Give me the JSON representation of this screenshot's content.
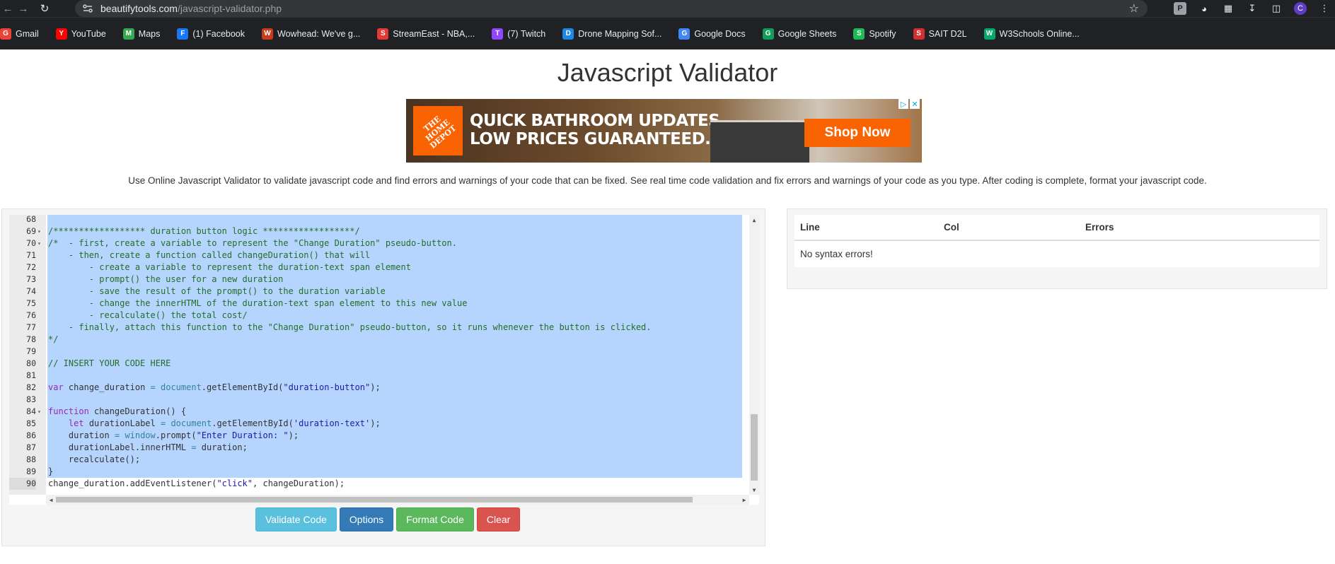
{
  "browser": {
    "url_host": "beautifytools.com",
    "url_path": "/javascript-validator.php",
    "bookmarks": [
      {
        "label": "Gmail",
        "icon": "gmail-icon",
        "color": "#ea4335"
      },
      {
        "label": "YouTube",
        "icon": "youtube-icon",
        "color": "#ff0000"
      },
      {
        "label": "Maps",
        "icon": "maps-icon",
        "color": "#34a853"
      },
      {
        "label": "(1) Facebook",
        "icon": "facebook-icon",
        "color": "#1877f2"
      },
      {
        "label": "Wowhead: We've g...",
        "icon": "wowhead-icon",
        "color": "#c83c1e"
      },
      {
        "label": "StreamEast - NBA,...",
        "icon": "streameast-icon",
        "color": "#e53935"
      },
      {
        "label": "(7) Twitch",
        "icon": "twitch-icon",
        "color": "#9146ff"
      },
      {
        "label": "Drone Mapping Sof...",
        "icon": "drone-icon",
        "color": "#1e88e5"
      },
      {
        "label": "Google Docs",
        "icon": "google-docs-icon",
        "color": "#4285f4"
      },
      {
        "label": "Google Sheets",
        "icon": "google-sheets-icon",
        "color": "#0f9d58"
      },
      {
        "label": "Spotify",
        "icon": "spotify-icon",
        "color": "#1db954"
      },
      {
        "label": "SAIT D2L",
        "icon": "sait-icon",
        "color": "#d32f2f"
      },
      {
        "label": "W3Schools Online...",
        "icon": "w3schools-icon",
        "color": "#04aa6d"
      }
    ],
    "avatar_letter": "C"
  },
  "page": {
    "title": "Javascript Validator",
    "description": "Use Online Javascript Validator to validate javascript code and find errors and warnings of your code that can be fixed. See real time code validation and fix errors and warnings of your code as you type. After coding is complete, format your javascript code."
  },
  "ad": {
    "logo_text": "THE HOME DEPOT",
    "headline_1": "QUICK BATHROOM UPDATES.",
    "headline_2": "LOW PRICES GUARANTEED.",
    "cta": "Shop Now"
  },
  "editor": {
    "lines": [
      {
        "n": "68",
        "fold": false,
        "text": ""
      },
      {
        "n": "69",
        "fold": true,
        "text": "/****************** duration button logic ******************/"
      },
      {
        "n": "70",
        "fold": true,
        "text": "/*  - first, create a variable to represent the \"Change Duration\" pseudo-button."
      },
      {
        "n": "71",
        "fold": false,
        "text": "    - then, create a function called changeDuration() that will"
      },
      {
        "n": "72",
        "fold": false,
        "text": "        - create a variable to represent the duration-text span element"
      },
      {
        "n": "73",
        "fold": false,
        "text": "        - prompt() the user for a new duration"
      },
      {
        "n": "74",
        "fold": false,
        "text": "        - save the result of the prompt() to the duration variable"
      },
      {
        "n": "75",
        "fold": false,
        "text": "        - change the innerHTML of the duration-text span element to this new value"
      },
      {
        "n": "76",
        "fold": false,
        "text": "        - recalculate() the total cost/"
      },
      {
        "n": "77",
        "fold": false,
        "text": "    - finally, attach this function to the \"Change Duration\" pseudo-button, so it runs whenever the button is clicked."
      },
      {
        "n": "78",
        "fold": false,
        "text": "*/"
      },
      {
        "n": "79",
        "fold": false,
        "text": ""
      },
      {
        "n": "80",
        "fold": false,
        "text": "// INSERT YOUR CODE HERE"
      },
      {
        "n": "81",
        "fold": false,
        "text": ""
      },
      {
        "n": "82",
        "fold": false,
        "text": "var change_duration = document.getElementById(\"duration-button\");"
      },
      {
        "n": "83",
        "fold": false,
        "text": ""
      },
      {
        "n": "84",
        "fold": true,
        "text": "function changeDuration() {"
      },
      {
        "n": "85",
        "fold": false,
        "text": "    let durationLabel = document.getElementById('duration-text');"
      },
      {
        "n": "86",
        "fold": false,
        "text": "    duration = window.prompt(\"Enter Duration: \");"
      },
      {
        "n": "87",
        "fold": false,
        "text": "    durationLabel.innerHTML = duration;"
      },
      {
        "n": "88",
        "fold": false,
        "text": "    recalculate();"
      },
      {
        "n": "89",
        "fold": false,
        "text": "}"
      },
      {
        "n": "90",
        "fold": false,
        "text": "change_duration.addEventListener(\"click\", changeDuration);"
      }
    ]
  },
  "buttons": {
    "validate": "Validate Code",
    "options": "Options",
    "format": "Format Code",
    "clear": "Clear"
  },
  "results": {
    "col_line": "Line",
    "col_col": "Col",
    "col_errors": "Errors",
    "message": "No syntax errors!"
  }
}
